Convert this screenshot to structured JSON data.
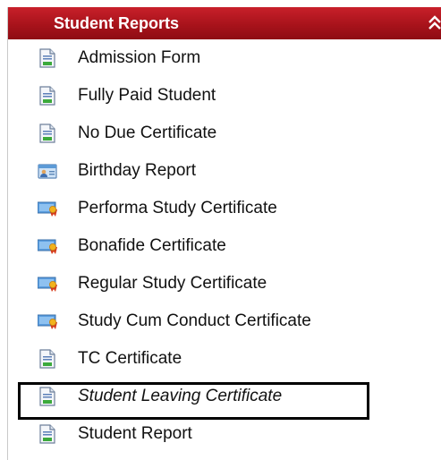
{
  "panel": {
    "title": "Student Reports",
    "collapse_icon": "double-chevron-up-icon",
    "accent_color": "#b01a22"
  },
  "items": [
    {
      "label": "Admission Form",
      "icon": "document-icon",
      "italic": false
    },
    {
      "label": "Fully Paid Student",
      "icon": "document-icon",
      "italic": false
    },
    {
      "label": "No Due Certificate",
      "icon": "document-icon",
      "italic": false
    },
    {
      "label": "Birthday Report",
      "icon": "id-card-icon",
      "italic": false
    },
    {
      "label": "Performa Study Certificate",
      "icon": "certificate-icon",
      "italic": false
    },
    {
      "label": "Bonafide Certificate",
      "icon": "certificate-icon",
      "italic": false
    },
    {
      "label": "Regular Study Certificate",
      "icon": "certificate-icon",
      "italic": false
    },
    {
      "label": "Study Cum Conduct Certificate",
      "icon": "certificate-icon",
      "italic": false
    },
    {
      "label": "TC Certificate",
      "icon": "document-icon",
      "italic": false
    },
    {
      "label": "Student Leaving Certificate",
      "icon": "document-icon",
      "italic": true
    },
    {
      "label": "Student Report",
      "icon": "document-icon",
      "italic": false
    }
  ],
  "highlighted_item": "Student Leaving Certificate"
}
